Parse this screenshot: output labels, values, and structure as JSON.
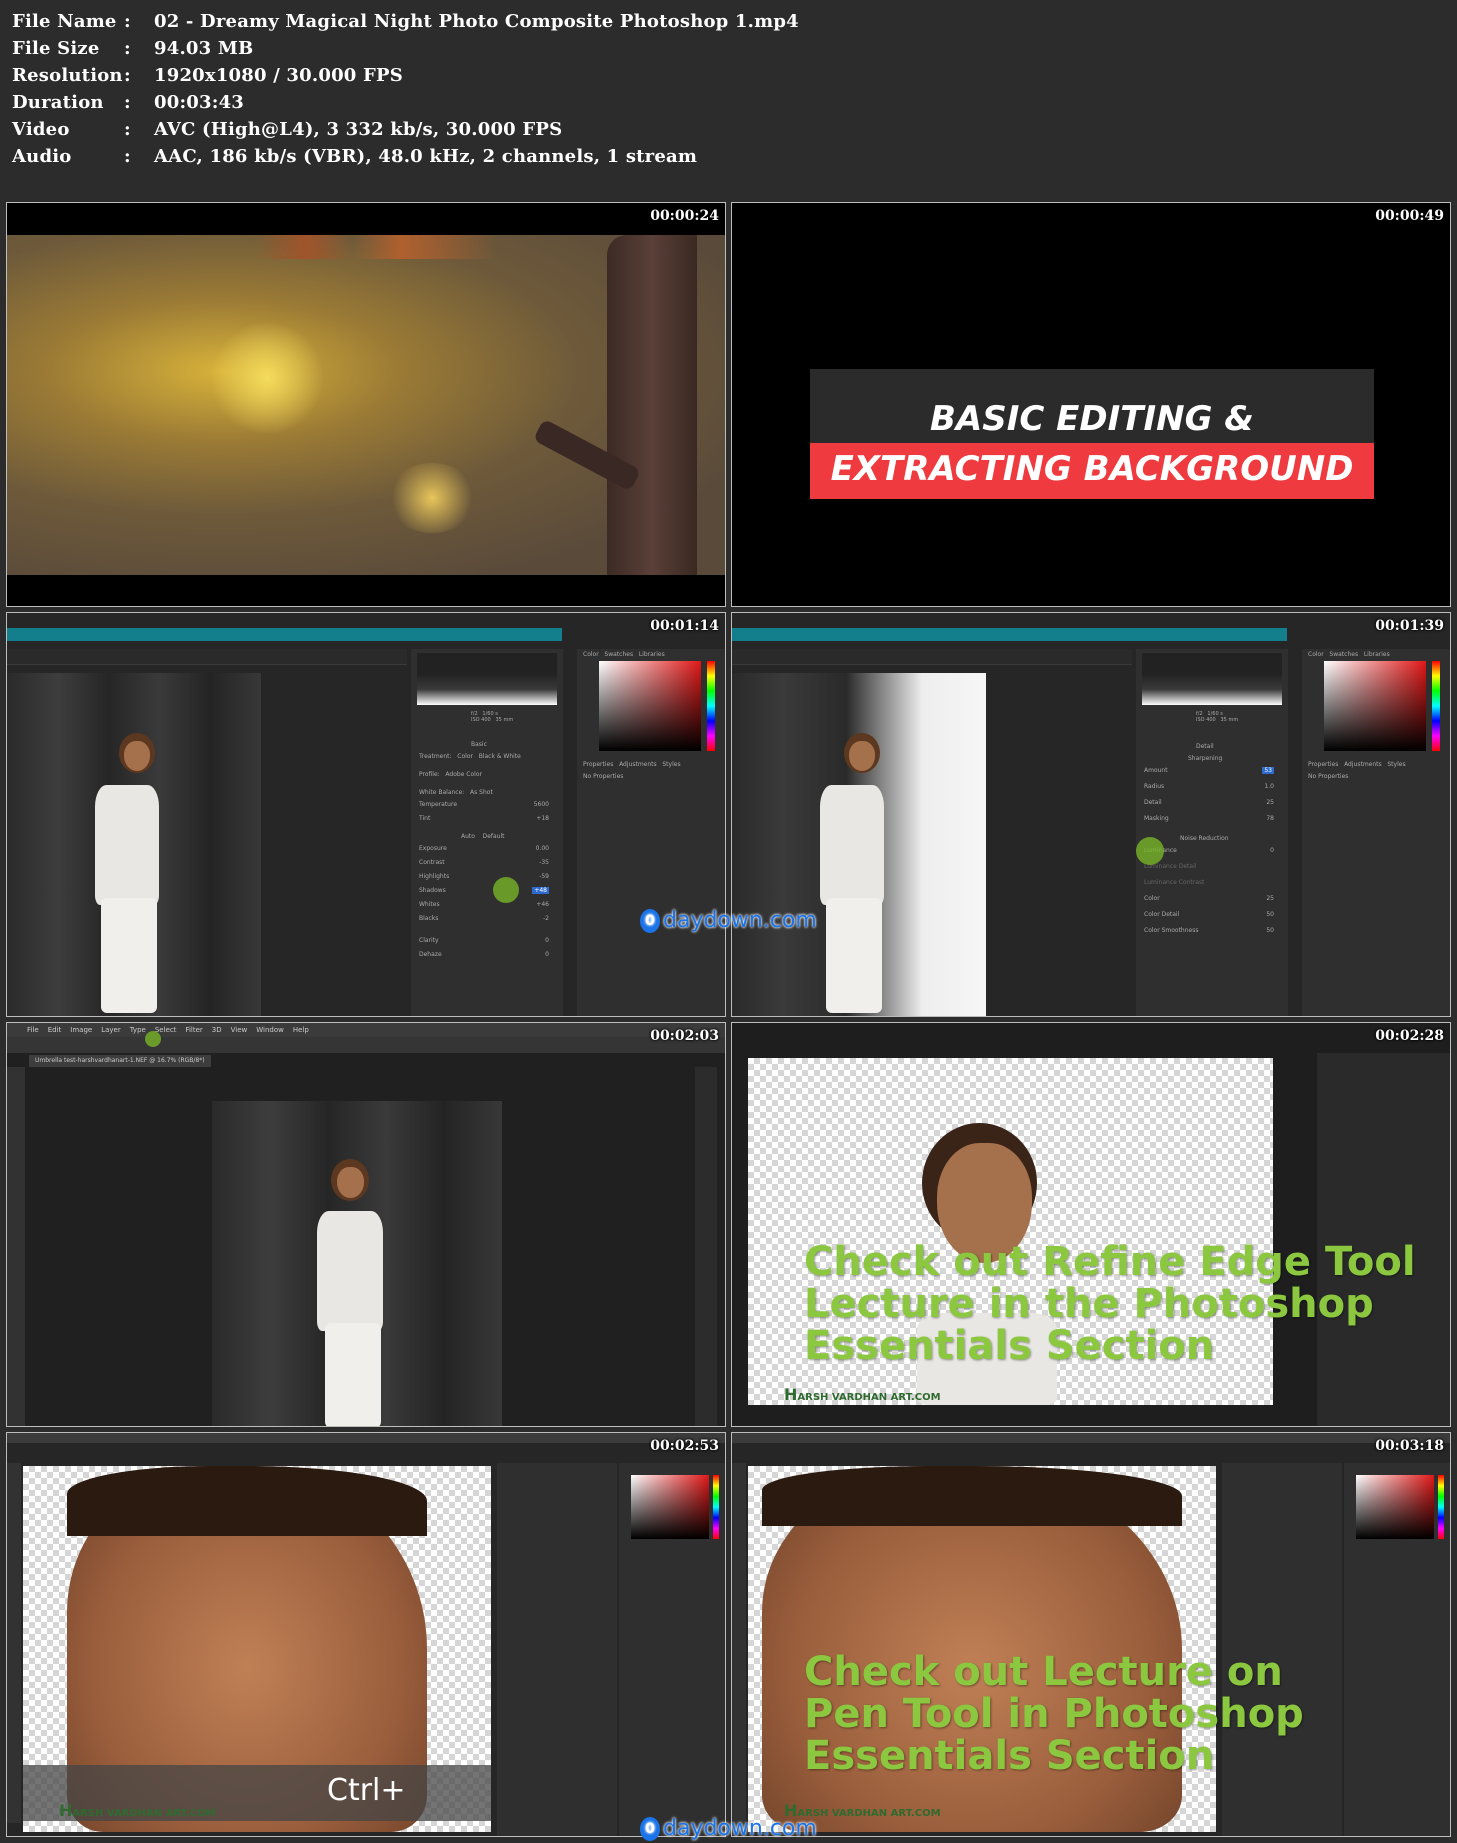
{
  "info": [
    {
      "key": "File Name",
      "value": "02 - Dreamy Magical Night Photo Composite Photoshop 1.mp4"
    },
    {
      "key": "File Size",
      "value": "94.03 MB"
    },
    {
      "key": "Resolution",
      "value": "1920x1080 / 30.000 FPS"
    },
    {
      "key": "Duration",
      "value": "00:03:43"
    },
    {
      "key": "Video",
      "value": "AVC (High@L4), 3 332 kb/s, 30.000 FPS"
    },
    {
      "key": "Audio",
      "value": "AAC, 186 kb/s (VBR), 48.0 kHz, 2 channels, 1 stream"
    }
  ],
  "separator": ":",
  "thumbs": [
    {
      "time": "00:00:24"
    },
    {
      "time": "00:00:49",
      "title_line1": "BASIC EDITING &",
      "title_line2": "EXTRACTING BACKGROUND"
    },
    {
      "time": "00:01:14"
    },
    {
      "time": "00:01:39"
    },
    {
      "time": "00:02:03"
    },
    {
      "time": "00:02:28",
      "overlay": [
        "Check out Refine Edge Tool",
        "Lecture in the Photoshop",
        "Essentials Section"
      ]
    },
    {
      "time": "00:02:53",
      "caption": "Ctrl+"
    },
    {
      "time": "00:03:18",
      "overlay": [
        "Check out Lecture on",
        "Pen Tool in Photoshop",
        "Essentials Section"
      ]
    }
  ],
  "watermark": "daydown.com",
  "watermark_icon": "0",
  "logo": "ARSH VARDHAN ART.COM",
  "logo_mark": "H",
  "ps_menu": [
    "File",
    "Edit",
    "Image",
    "Layer",
    "Type",
    "Select",
    "Filter",
    "3D",
    "View",
    "Window",
    "Help"
  ],
  "doc_tab": "Umbrella test-harshvardhanart-1.NEF @ 16.7% (RGB/8*)",
  "camera_raw": {
    "basic_title": "Basic",
    "treatment": "Treatment:",
    "color": "Color",
    "bw": "Black & White",
    "profile": "Profile:",
    "profile_val": "Adobe Color",
    "wb": "White Balance:",
    "wb_val": "As Shot",
    "sliders": [
      {
        "label": "Temperature",
        "value": "5600"
      },
      {
        "label": "Tint",
        "value": "+18"
      },
      {
        "label": "Exposure",
        "value": "0.00"
      },
      {
        "label": "Contrast",
        "value": "-35"
      },
      {
        "label": "Highlights",
        "value": "-59"
      },
      {
        "label": "Shadows",
        "value": "+48"
      },
      {
        "label": "Whites",
        "value": "+46"
      },
      {
        "label": "Blacks",
        "value": "-2"
      },
      {
        "label": "Clarity",
        "value": "0"
      },
      {
        "label": "Dehaze",
        "value": "0"
      }
    ],
    "auto": "Auto",
    "default": "Default",
    "detail_title": "Detail",
    "sharpening": "Sharpening",
    "detail_sliders": [
      {
        "label": "Amount",
        "value": "53"
      },
      {
        "label": "Radius",
        "value": "1.0"
      },
      {
        "label": "Detail",
        "value": "25"
      },
      {
        "label": "Masking",
        "value": "78"
      }
    ],
    "noise": "Noise Reduction",
    "noise_sliders": [
      {
        "label": "Luminance",
        "value": "0"
      },
      {
        "label": "Luminance Detail",
        "value": ""
      },
      {
        "label": "Luminance Contrast",
        "value": ""
      },
      {
        "label": "Color",
        "value": "25"
      },
      {
        "label": "Color Detail",
        "value": "50"
      },
      {
        "label": "Color Smoothness",
        "value": "50"
      }
    ],
    "exif_f": "f/2",
    "exif_s": "1/60 s",
    "exif_iso": "ISO 400",
    "exif_mm": "35 mm"
  },
  "panels": {
    "color": "Color",
    "swatches": "Swatches",
    "libraries": "Libraries",
    "properties": "Properties",
    "adjustments": "Adjustments",
    "styles": "Styles",
    "no_properties": "No Properties"
  },
  "colors": {
    "teal": "#137f8c",
    "accent_red": "#ef3b3f",
    "green_text": "#8cc83f",
    "watermark_blue": "#1a73e8"
  }
}
